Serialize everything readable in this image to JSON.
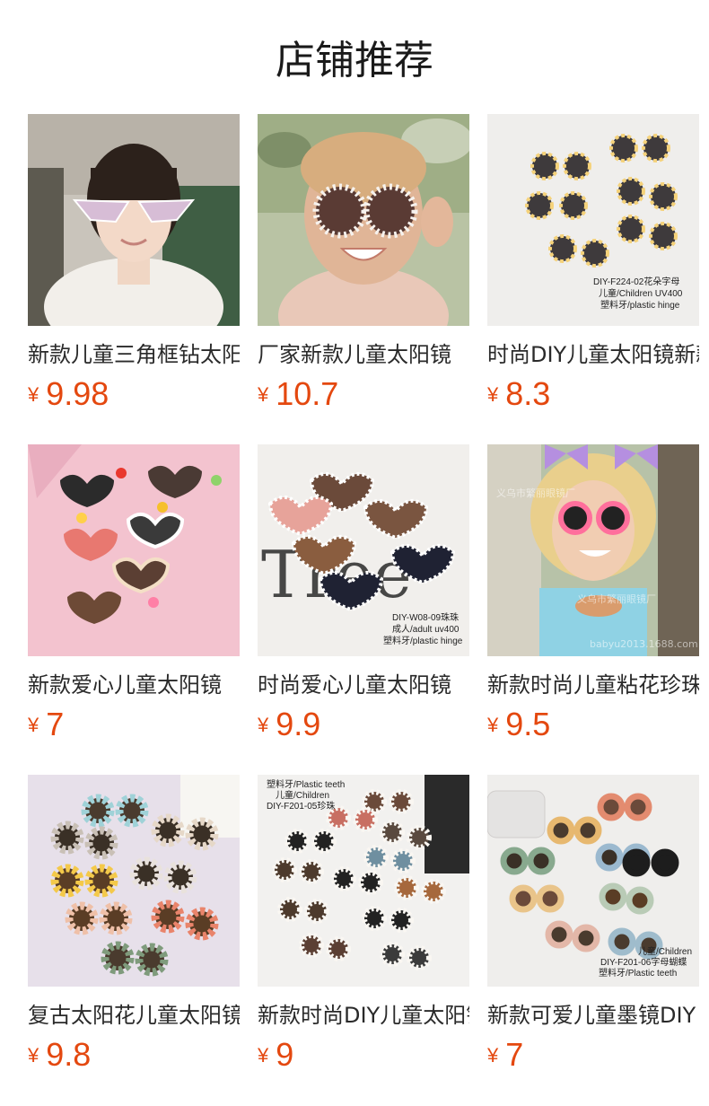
{
  "header": {
    "title": "店铺推荐"
  },
  "currency_symbol": "¥",
  "products": [
    {
      "name": "新款儿童三角框钻太阳镜",
      "price": "9.98",
      "image": "girl-triangle-rhinestone-sunglasses"
    },
    {
      "name": "厂家新款儿童太阳镜",
      "price": "10.7",
      "image": "toddler-pearl-round-sunglasses"
    },
    {
      "name": "时尚DIY儿童太阳镜新款",
      "price": "8.3",
      "image": "flower-sunglasses-flatlay",
      "caption": [
        "DIY-F224-02花朵字母",
        "儿童/Children UV400",
        "塑料牙/plastic hinge"
      ]
    },
    {
      "name": "新款爱心儿童太阳镜",
      "price": "7",
      "image": "heart-sunglasses-pink-bg"
    },
    {
      "name": "时尚爱心儿童太阳镜",
      "price": "9.9",
      "image": "heart-pearl-sunglasses",
      "caption": [
        "DIY-W08-09珠珠",
        "成人/adult uv400",
        "塑料牙/plastic hinge"
      ]
    },
    {
      "name": "新款时尚儿童粘花珍珠",
      "price": "9.5",
      "image": "girl-bows-flower-sunglasses",
      "watermark": [
        "义乌市繁丽眼镜厂",
        "义乌市繁丽眼镜厂",
        "babyu2013.1688.com"
      ]
    },
    {
      "name": "复古太阳花儿童太阳镜",
      "price": "9.8",
      "image": "retro-sunflower-sunglasses"
    },
    {
      "name": "新款时尚DIY儿童太阳镜",
      "price": "9",
      "image": "pearl-round-sunglasses",
      "caption": [
        "塑料牙/Plastic teeth",
        "儿童/Children",
        "DIY-F201-05珍珠"
      ]
    },
    {
      "name": "新款可爱儿童墨镜DIY",
      "price": "7",
      "image": "pastel-round-sunglasses",
      "caption": [
        "儿童/Children",
        "DIY-F201-06字母蝴蝶",
        "塑料牙/Plastic teeth"
      ]
    }
  ]
}
